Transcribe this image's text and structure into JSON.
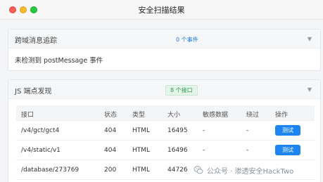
{
  "window": {
    "title": "安全扫描结果"
  },
  "cross_domain_panel": {
    "title": "跨域消息追踪",
    "badge": "0 个事件",
    "empty_message": "未检测到 postMessage 事件",
    "arrow_icon": "triangle-down-icon"
  },
  "endpoint_panel": {
    "title": "JS 端点发现",
    "badge": "8 个接口",
    "arrow_icon": "triangle-down-icon",
    "columns": [
      "接口",
      "状态",
      "类型",
      "大小",
      "敏感数据",
      "绕过",
      "操作"
    ],
    "rows": [
      {
        "path": "/v4/gct/gct4",
        "status": "404",
        "type": "HTML",
        "size": "16495",
        "sensitive": "-",
        "bypass": "-",
        "action": "测试"
      },
      {
        "path": "/v4/static/v1",
        "status": "404",
        "type": "HTML",
        "size": "16496",
        "sensitive": "-",
        "bypass": "-",
        "action": "测试"
      },
      {
        "path": "/database/273769",
        "status": "200",
        "type": "HTML",
        "size": "44726",
        "sensitive": "",
        "bypass": "",
        "action": ""
      }
    ]
  },
  "watermark": {
    "text": "公众号 · 渗透安全HackTwo"
  },
  "colors": {
    "accent_blue": "#1d84f0",
    "badge_green": "#2b9b49",
    "close": "#ff5f57",
    "minimize": "#febc2e",
    "maximize": "#28c840"
  }
}
